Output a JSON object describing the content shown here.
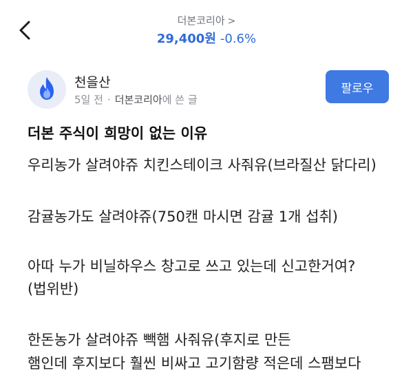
{
  "header": {
    "stock_name": "더본코리아",
    "stock_chevron": ">",
    "price": "29,400원",
    "change": "-0.6%",
    "accent_color": "#2f6ad8"
  },
  "author": {
    "name": "천을산",
    "time_ago": "5일 전",
    "separator": "·",
    "source_name": "더본코리아",
    "source_suffix": "에 쓴 글",
    "follow_label": "팔로우"
  },
  "post": {
    "title": "더본 주식이 희망이 없는 이유",
    "paragraphs": [
      "우리농가 살려야쥬 치킨스테이크 사줘유(브라질산 닭다리)",
      "감귤농가도 살려야쥬(750캔 마시면 감귤 1개 섭취)",
      "아따 누가 비닐하우스 창고로 쓰고 있는데 신고한거여?",
      "(법위반)",
      "한돈농가 살려야쥬 빽햄 사줘유(후지로 만든",
      "햄인데 후지보다 훨씬 비싸고 고기함량 적은데 스팸보다"
    ]
  }
}
